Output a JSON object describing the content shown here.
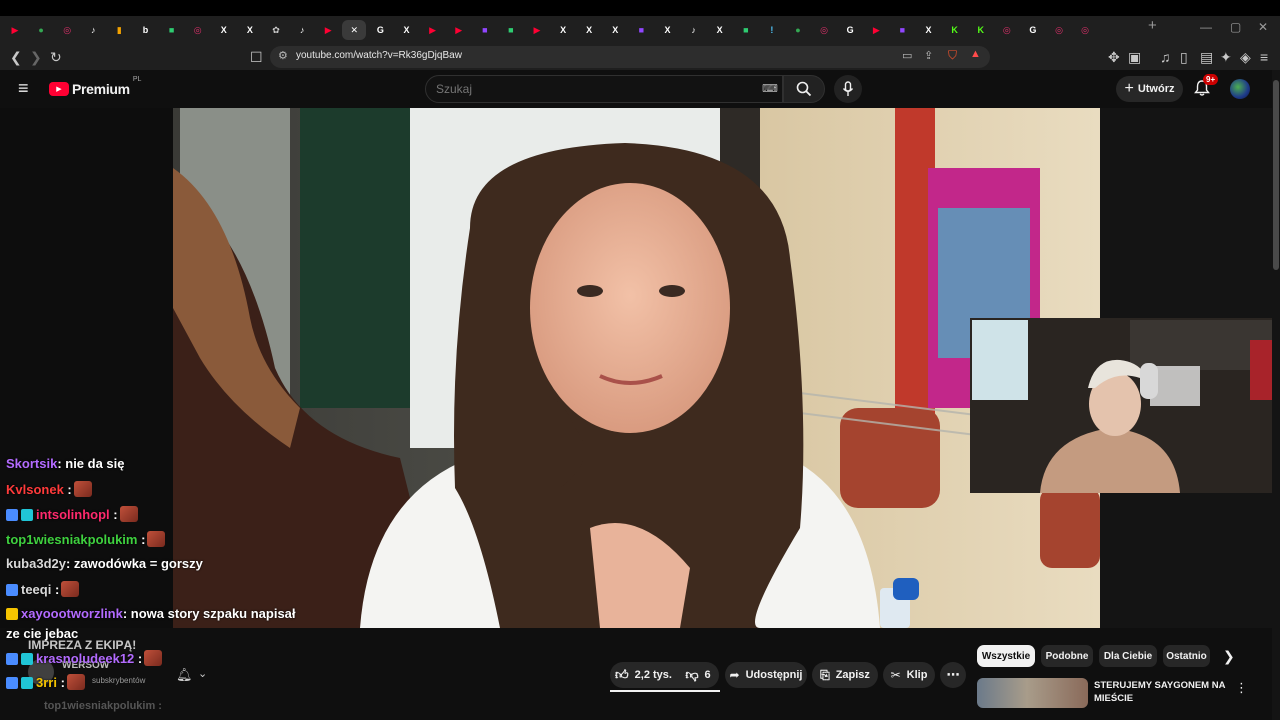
{
  "browser": {
    "tabs": [
      {
        "icon": "youtube-icon",
        "glyph": "▶",
        "color": "#ff0033"
      },
      {
        "icon": "maps-icon",
        "glyph": "●",
        "color": "#34a853"
      },
      {
        "icon": "instagram-icon",
        "glyph": "◎",
        "color": "#e1306c"
      },
      {
        "icon": "tiktok-icon",
        "glyph": "♪",
        "color": "#ffffff"
      },
      {
        "icon": "bookmark-icon",
        "glyph": "▮",
        "color": "#f4a300"
      },
      {
        "icon": "b-icon",
        "glyph": "b",
        "color": "#ffffff"
      },
      {
        "icon": "chat-icon",
        "glyph": "■",
        "color": "#2ecc71"
      },
      {
        "icon": "instagram-icon",
        "glyph": "◎",
        "color": "#e1306c"
      },
      {
        "icon": "x-icon",
        "glyph": "X",
        "color": "#ffffff"
      },
      {
        "icon": "x-icon",
        "glyph": "X",
        "color": "#ffffff"
      },
      {
        "icon": "openai-icon",
        "glyph": "✿",
        "color": "#cccccc"
      },
      {
        "icon": "tiktok-icon",
        "glyph": "♪",
        "color": "#ffffff"
      },
      {
        "icon": "youtube-icon",
        "glyph": "▶",
        "color": "#ff0033"
      },
      {
        "icon": "close-icon",
        "glyph": "✕",
        "color": "#ffffff"
      },
      {
        "icon": "google-icon",
        "glyph": "G",
        "color": "#ffffff"
      },
      {
        "icon": "x-icon",
        "glyph": "X",
        "color": "#ffffff"
      },
      {
        "icon": "youtube-icon",
        "glyph": "▶",
        "color": "#ff0033"
      },
      {
        "icon": "youtube-icon",
        "glyph": "▶",
        "color": "#ff0033"
      },
      {
        "icon": "twitch-icon",
        "glyph": "■",
        "color": "#9146ff"
      },
      {
        "icon": "chat-icon",
        "glyph": "■",
        "color": "#2ecc71"
      },
      {
        "icon": "youtube-icon",
        "glyph": "▶",
        "color": "#ff0033"
      },
      {
        "icon": "x-icon",
        "glyph": "X",
        "color": "#ffffff"
      },
      {
        "icon": "x-icon",
        "glyph": "X",
        "color": "#ffffff"
      },
      {
        "icon": "x-icon",
        "glyph": "X",
        "color": "#ffffff"
      },
      {
        "icon": "twitch-icon",
        "glyph": "■",
        "color": "#9146ff"
      },
      {
        "icon": "x-icon",
        "glyph": "X",
        "color": "#ffffff"
      },
      {
        "icon": "tiktok-icon",
        "glyph": "♪",
        "color": "#ffffff"
      },
      {
        "icon": "x-icon",
        "glyph": "X",
        "color": "#ffffff"
      },
      {
        "icon": "chat-icon",
        "glyph": "■",
        "color": "#2ecc71"
      },
      {
        "icon": "pin-icon",
        "glyph": "!",
        "color": "#4fc3f7"
      },
      {
        "icon": "maps-icon",
        "glyph": "●",
        "color": "#34a853"
      },
      {
        "icon": "instagram-icon",
        "glyph": "◎",
        "color": "#e1306c"
      },
      {
        "icon": "google-icon",
        "glyph": "G",
        "color": "#ffffff"
      },
      {
        "icon": "youtube-icon",
        "glyph": "▶",
        "color": "#ff0033"
      },
      {
        "icon": "twitch-icon",
        "glyph": "■",
        "color": "#9146ff"
      },
      {
        "icon": "x-icon",
        "glyph": "X",
        "color": "#ffffff"
      },
      {
        "icon": "kick-icon",
        "glyph": "K",
        "color": "#53fc18"
      },
      {
        "icon": "kick-icon",
        "glyph": "K",
        "color": "#53fc18"
      },
      {
        "icon": "instagram-icon",
        "glyph": "◎",
        "color": "#e1306c"
      },
      {
        "icon": "google-icon",
        "glyph": "G",
        "color": "#ffffff"
      },
      {
        "icon": "instagram-icon",
        "glyph": "◎",
        "color": "#e1306c"
      },
      {
        "icon": "instagram-icon",
        "glyph": "◎",
        "color": "#e1306c"
      }
    ],
    "new_tab_glyph": "+",
    "url": "youtube.com/watch?v=Rk36gDjqBaw"
  },
  "youtube": {
    "brand": "Premium",
    "brand_region": "PL",
    "search_placeholder": "Szukaj",
    "create_label": "Utwórz",
    "notifications_badge": "9+",
    "accent": "#ff0033"
  },
  "chat": {
    "messages": [
      {
        "user": "Skortsik",
        "color": "#b36bff",
        "text": ": nie da się",
        "emote": false
      },
      {
        "user": "Kvlsonek",
        "color": "#ff3b3b",
        "text": " :",
        "emote": true
      },
      {
        "user": "intsolinhopl",
        "color": "#ff2a6d",
        "text": " :",
        "emote": true
      },
      {
        "user": "top1wiesniakpolukim",
        "color": "#3fd13f",
        "text": " :",
        "emote": true
      },
      {
        "user": "kuba3d2y",
        "color": "#d9d9d9",
        "text": ": zawodówka = gorszy",
        "emote": false
      },
      {
        "user": "teeqi",
        "color": "#d9d9d9",
        "text": " :",
        "emote": true
      },
      {
        "user": "xayoootworzlink",
        "color": "#b36bff",
        "text": ": nowa story szpaku napisał",
        "emote": false
      },
      {
        "user": "",
        "color": "#ffffff",
        "text": "ze cie jebac",
        "emote": false
      },
      {
        "user": "krasnoludeek12",
        "color": "#b36bff",
        "text": " :",
        "emote": true
      },
      {
        "user": "3rri",
        "color": "#f5c400",
        "text": " :",
        "emote": true
      }
    ],
    "overlay_title": "IMPREZA Z EKIPĄ!",
    "channel_name": "WERSOW",
    "subscribers_label": "subskrybentów",
    "ghost_line": "top1wiesniakpolukim :"
  },
  "actions": {
    "likes": "2,2 tys.",
    "dislikes": "6",
    "share": "Udostępnij",
    "save": "Zapisz",
    "clip": "Klip",
    "more": "⋯"
  },
  "chips": [
    "Wszystkie",
    "Podobne",
    "Dla Ciebie",
    "Ostatnio"
  ],
  "recommended": {
    "title_line1": "STERUJEMY SAYGONEM NA",
    "title_line2": "MIEŚCIE"
  }
}
